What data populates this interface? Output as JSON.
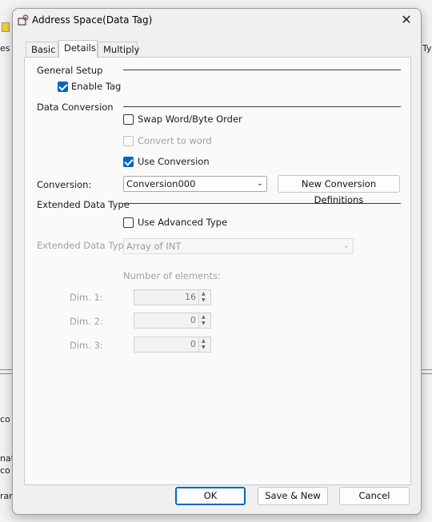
{
  "background": {
    "fragments": [
      "es",
      "Ty",
      "co",
      "nat",
      "co",
      "ran"
    ]
  },
  "dialog": {
    "title": "Address Space(Data Tag)",
    "close_label": "✕",
    "tabs": [
      {
        "label": "Basic",
        "active": false
      },
      {
        "label": "Details",
        "active": true
      },
      {
        "label": "Multiply",
        "active": false
      }
    ],
    "general_setup": {
      "heading": "General Setup",
      "enable_tag": {
        "label": "Enable Tag",
        "checked": true
      }
    },
    "data_conversion": {
      "heading": "Data Conversion",
      "swap_order": {
        "label": "Swap Word/Byte Order",
        "checked": false
      },
      "convert_to_word": {
        "label": "Convert to word",
        "checked": false,
        "enabled": false
      },
      "use_conversion": {
        "label": "Use Conversion",
        "checked": true
      },
      "conversion_label": "Conversion:",
      "conversion_value": "Conversion000",
      "new_definitions_button": "New Conversion Definitions"
    },
    "extended_data_type": {
      "heading": "Extended Data Type",
      "use_advanced": {
        "label": "Use Advanced Type",
        "checked": false
      },
      "type_label": "Extended Data Type",
      "type_value": "Array of INT",
      "elements_label": "Number of elements:",
      "dims": [
        {
          "label": "Dim. 1:",
          "value": "16"
        },
        {
          "label": "Dim. 2:",
          "value": "0"
        },
        {
          "label": "Dim. 3:",
          "value": "0"
        }
      ]
    },
    "buttons": {
      "ok": "OK",
      "save_new": "Save & New",
      "cancel": "Cancel"
    },
    "icons": {
      "title_icon": "tag-settings-icon",
      "dropdown": "chevron-down-icon",
      "spin_up": "spin-up-icon",
      "spin_down": "spin-down-icon"
    },
    "colors": {
      "accent": "#0067c0",
      "disabled_text": "#a0a0a0"
    }
  }
}
